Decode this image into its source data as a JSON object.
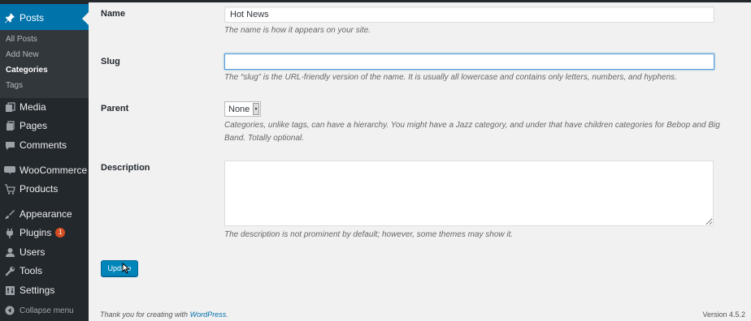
{
  "sidebar": {
    "posts_label": "Posts",
    "submenu": [
      "All Posts",
      "Add New",
      "Categories",
      "Tags"
    ],
    "items": [
      {
        "label": "Media"
      },
      {
        "label": "Pages"
      },
      {
        "label": "Comments"
      },
      {
        "label": "WooCommerce"
      },
      {
        "label": "Products"
      },
      {
        "label": "Appearance"
      },
      {
        "label": "Plugins",
        "badge": "1"
      },
      {
        "label": "Users"
      },
      {
        "label": "Tools"
      },
      {
        "label": "Settings"
      }
    ],
    "collapse_label": "Collapse menu"
  },
  "form": {
    "name": {
      "label": "Name",
      "value": "Hot News",
      "description": "The name is how it appears on your site."
    },
    "slug": {
      "label": "Slug",
      "value": "",
      "description": "The “slug” is the URL-friendly version of the name. It is usually all lowercase and contains only letters, numbers, and hyphens."
    },
    "parent": {
      "label": "Parent",
      "selected": "None",
      "description": "Categories, unlike tags, can have a hierarchy. You might have a Jazz category, and under that have children categories for Bebop and Big Band. Totally optional."
    },
    "description": {
      "label": "Description",
      "value": "",
      "description": "The description is not prominent by default; however, some themes may show it."
    },
    "update_label": "Update"
  },
  "footer": {
    "thanks_prefix": "Thank you for creating with",
    "thanks_link": "WordPress",
    "thanks_suffix": ".",
    "version": "Version 4.5.2"
  },
  "colors": {
    "sidebar_bg": "#23282d",
    "accent": "#0073aa",
    "button": "#0085ba",
    "badge": "#d54e21"
  }
}
